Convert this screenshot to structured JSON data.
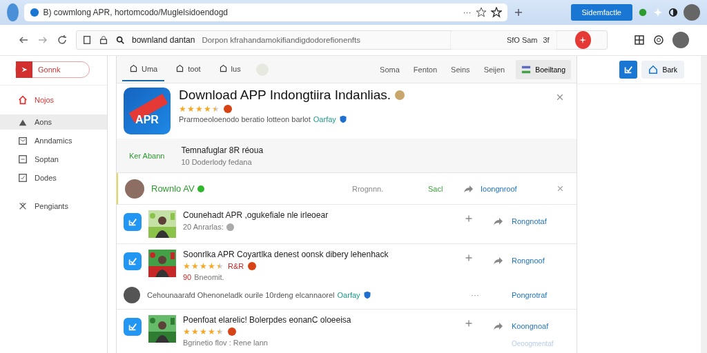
{
  "browser": {
    "address": "B) cowmlong APR, hortomcodo/Muglelsidoendogd",
    "menu": "···",
    "button": "Sidemfactle"
  },
  "toolbar": {
    "site": "bownland dantan",
    "path": "Dorpon kfrahandamokifiandigdodorefionenfts",
    "search": "SfO Sam",
    "search_hint": "3f"
  },
  "sidebar": {
    "brand": "Gonnk",
    "items": [
      {
        "label": "Nojos",
        "accent": true,
        "selected": false
      },
      {
        "label": "Aons",
        "accent": false,
        "selected": true
      },
      {
        "label": "Anndamics",
        "accent": false,
        "selected": false
      },
      {
        "label": "Soptan",
        "accent": false,
        "selected": false
      },
      {
        "label": "Dodes",
        "accent": false,
        "selected": false
      },
      {
        "label": "Pengiants",
        "accent": false,
        "selected": false
      }
    ]
  },
  "tabs": [
    {
      "label": "Uma",
      "selected": true
    },
    {
      "label": "toot",
      "selected": false
    },
    {
      "label": "lus",
      "selected": false
    }
  ],
  "links": [
    "Soma",
    "Fenton",
    "Seins",
    "Seijen"
  ],
  "action_button": "Boeiltang",
  "app": {
    "title": "Download APP Indongtiira Indanlias.",
    "stars": 4.5,
    "description": "Prarmoeoloenodo beratio lotteon barlot",
    "link": "Oarfay",
    "icon_text": "APR"
  },
  "promo": {
    "label": "Ker Abann",
    "title": "Temnafuglar 8R réoua",
    "subtitle": "10 Doderlody fedana"
  },
  "rows": [
    {
      "kind": "featured",
      "title": "Rownlo AV",
      "status": "Rrognnn.",
      "tag": "Sacl",
      "action": "Ioongnroof"
    },
    {
      "kind": "app",
      "title": "Counehadt APR ,ogukefiale nle irleoear",
      "meta": "20 Anrarlas:",
      "action": "Rongnotaf"
    },
    {
      "kind": "app",
      "title": "Soonrlka APR Coyartlka denest oonsk dibery lehenhack",
      "stars": 4.5,
      "badge": "R&R",
      "count": "90",
      "meta": "Bneomit.",
      "action": "Rongnoof",
      "comment": {
        "text": "Cehounaarafd Ohenoneladk ourile 10rdeng elcannaorel",
        "link": "Oarfay",
        "menu": "···",
        "action": "Pongrotraf"
      }
    },
    {
      "kind": "app",
      "title": "Poenfoat elarelic! Bolerpdes eonanC oloeeisa",
      "stars": 4.5,
      "meta": "Bgrinetio flov : Rene lann",
      "action": "Koongnoaf",
      "secondary": "Oeoogmentaf"
    }
  ],
  "side_panel": {
    "button": "Bark"
  }
}
